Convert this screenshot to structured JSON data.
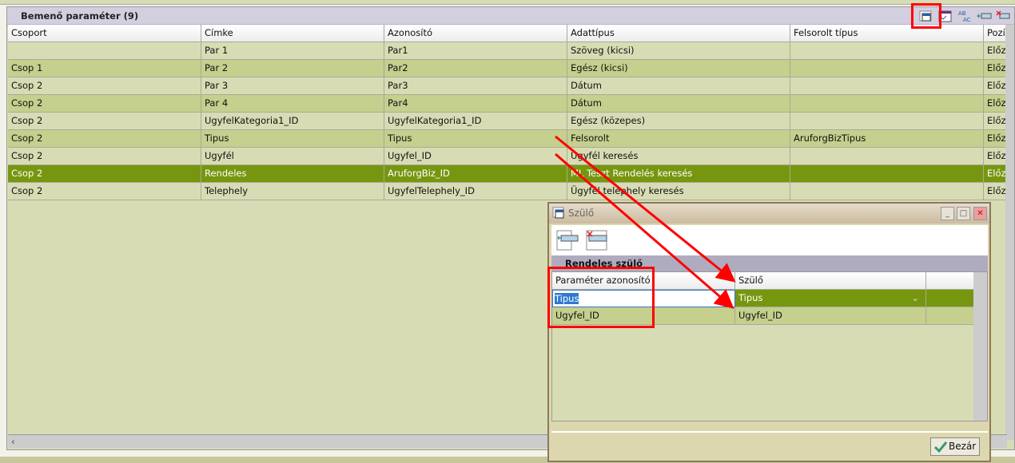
{
  "panel": {
    "title": "Bemenő paraméter (9)",
    "toolbar": [
      "window-icon",
      "edit-icon",
      "replace-text-icon",
      "insert-row-icon",
      "delete-row-icon"
    ]
  },
  "columns": [
    "Csoport",
    "Címke",
    "Azonosító",
    "Adattípus",
    "Felsorolt típus",
    "Pozíc"
  ],
  "rows": [
    [
      "",
      "Par 1",
      "Par1",
      "Szöveg (kicsi)",
      "",
      "Előző"
    ],
    [
      "Csop 1",
      "Par 2",
      "Par2",
      "Egész (kicsi)",
      "",
      "Előző"
    ],
    [
      "Csop 2",
      "Par 3",
      "Par3",
      "Dátum",
      "",
      "Előző"
    ],
    [
      "Csop 2",
      "Par 4",
      "Par4",
      "Dátum",
      "",
      "Előző"
    ],
    [
      "Csop 2",
      "UgyfelKategoria1_ID",
      "UgyfelKategoria1_ID",
      "Egész (közepes)",
      "",
      "Előző"
    ],
    [
      "Csop 2",
      "Tipus",
      "Tipus",
      "Felsorolt",
      "AruforgBizTipus",
      "Előző"
    ],
    [
      "Csop 2",
      "Ugyfél",
      "Ugyfel_ID",
      "Ugyfél keresés",
      "",
      "Előző"
    ],
    [
      "Csop 2",
      "Rendeles",
      "AruforgBiz_ID",
      "ML Teszt Rendelés keresés",
      "",
      "Előző"
    ],
    [
      "Csop 2",
      "Telephely",
      "UgyfelTelephely_ID",
      "Ügyfél telephely keresés",
      "",
      "Előző"
    ]
  ],
  "selected_row": 7,
  "dialog": {
    "title": "Szülő",
    "group": "Rendeles szülő",
    "columns": [
      "Paraméter azonosító",
      "Szülő"
    ],
    "rows": [
      [
        "Tipus",
        "Tipus"
      ],
      [
        "Ugyfel_ID",
        "Ugyfel_ID"
      ]
    ],
    "close_label": "Bezár"
  },
  "colors": {
    "selected": "#77960f",
    "row_light": "#d8dcb4",
    "row_alt": "#c5cf8e",
    "annotation": "#ff0000"
  }
}
